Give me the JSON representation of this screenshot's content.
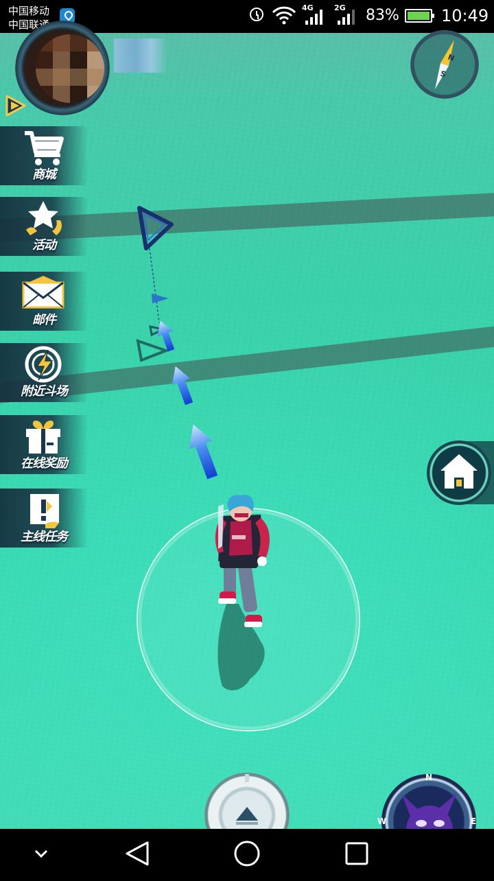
{
  "status_bar": {
    "carrier_1": "中国移动",
    "carrier_2": "中国联通",
    "net_1": "4G",
    "net_2": "2G",
    "battery": "83%",
    "time": "10:49"
  },
  "side_menu": [
    {
      "id": "shop",
      "label": "商城",
      "icon": "shopping-cart-icon"
    },
    {
      "id": "events",
      "label": "活动",
      "icon": "star-icon"
    },
    {
      "id": "mail",
      "label": "邮件",
      "icon": "envelope-icon"
    },
    {
      "id": "nearby",
      "label": "附近斗场",
      "icon": "lightning-icon"
    },
    {
      "id": "online",
      "label": "在线奖励",
      "icon": "gift-icon"
    },
    {
      "id": "quest",
      "label": "主线任务",
      "icon": "quest-scroll-icon"
    }
  ],
  "compass": {
    "north": "N",
    "south": "S"
  },
  "radar": {
    "north": "N",
    "west": "W",
    "east": "E"
  },
  "colors": {
    "grass": "#34d7ae",
    "menu_bg": "#143040",
    "arrow_blue": "#1e6be0",
    "marker_blue": "#1a3a8c"
  }
}
